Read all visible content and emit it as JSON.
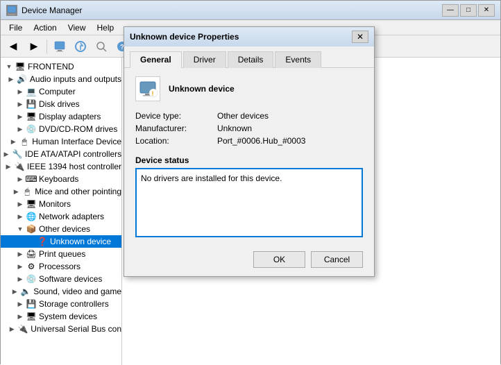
{
  "app": {
    "title": "Device Manager",
    "icon": "🖥"
  },
  "title_buttons": {
    "minimize": "—",
    "maximize": "□",
    "close": "✕"
  },
  "menu": {
    "items": [
      "File",
      "Action",
      "View",
      "Help"
    ]
  },
  "sidebar": {
    "root": "FRONTEND",
    "items": [
      {
        "label": "Audio inputs and outputs",
        "depth": 1,
        "icon": "🔊",
        "expanded": false
      },
      {
        "label": "Computer",
        "depth": 1,
        "icon": "💻",
        "expanded": false
      },
      {
        "label": "Disk drives",
        "depth": 1,
        "icon": "💾",
        "expanded": false
      },
      {
        "label": "Display adapters",
        "depth": 1,
        "icon": "🖥",
        "expanded": false
      },
      {
        "label": "DVD/CD-ROM drives",
        "depth": 1,
        "icon": "💿",
        "expanded": false
      },
      {
        "label": "Human Interface Device",
        "depth": 1,
        "icon": "🖱",
        "expanded": false
      },
      {
        "label": "IDE ATA/ATAPI controllers",
        "depth": 1,
        "icon": "🔧",
        "expanded": false
      },
      {
        "label": "IEEE 1394 host controller",
        "depth": 1,
        "icon": "🔌",
        "expanded": false
      },
      {
        "label": "Keyboards",
        "depth": 1,
        "icon": "⌨",
        "expanded": false
      },
      {
        "label": "Mice and other pointing",
        "depth": 1,
        "icon": "🖱",
        "expanded": false
      },
      {
        "label": "Monitors",
        "depth": 1,
        "icon": "🖥",
        "expanded": false
      },
      {
        "label": "Network adapters",
        "depth": 1,
        "icon": "🌐",
        "expanded": false
      },
      {
        "label": "Other devices",
        "depth": 1,
        "icon": "📦",
        "expanded": true
      },
      {
        "label": "Unknown device",
        "depth": 2,
        "icon": "❓",
        "expanded": false,
        "selected": true
      },
      {
        "label": "Print queues",
        "depth": 1,
        "icon": "🖨",
        "expanded": false
      },
      {
        "label": "Processors",
        "depth": 1,
        "icon": "⚙",
        "expanded": false
      },
      {
        "label": "Software devices",
        "depth": 1,
        "icon": "💿",
        "expanded": false
      },
      {
        "label": "Sound, video and game",
        "depth": 1,
        "icon": "🔈",
        "expanded": false
      },
      {
        "label": "Storage controllers",
        "depth": 1,
        "icon": "💾",
        "expanded": false
      },
      {
        "label": "System devices",
        "depth": 1,
        "icon": "🖥",
        "expanded": false
      },
      {
        "label": "Universal Serial Bus con",
        "depth": 1,
        "icon": "🔌",
        "expanded": false
      }
    ]
  },
  "dialog": {
    "title": "Unknown device Properties",
    "tabs": [
      "General",
      "Driver",
      "Details",
      "Events"
    ],
    "active_tab": "General",
    "device_name": "Unknown device",
    "fields": {
      "device_type_label": "Device type:",
      "device_type_value": "Other devices",
      "manufacturer_label": "Manufacturer:",
      "manufacturer_value": "Unknown",
      "location_label": "Location:",
      "location_value": "Port_#0006.Hub_#0003"
    },
    "status_label": "Device status",
    "status_text": "No drivers are installed for this device.",
    "buttons": {
      "ok": "OK",
      "cancel": "Cancel"
    }
  }
}
